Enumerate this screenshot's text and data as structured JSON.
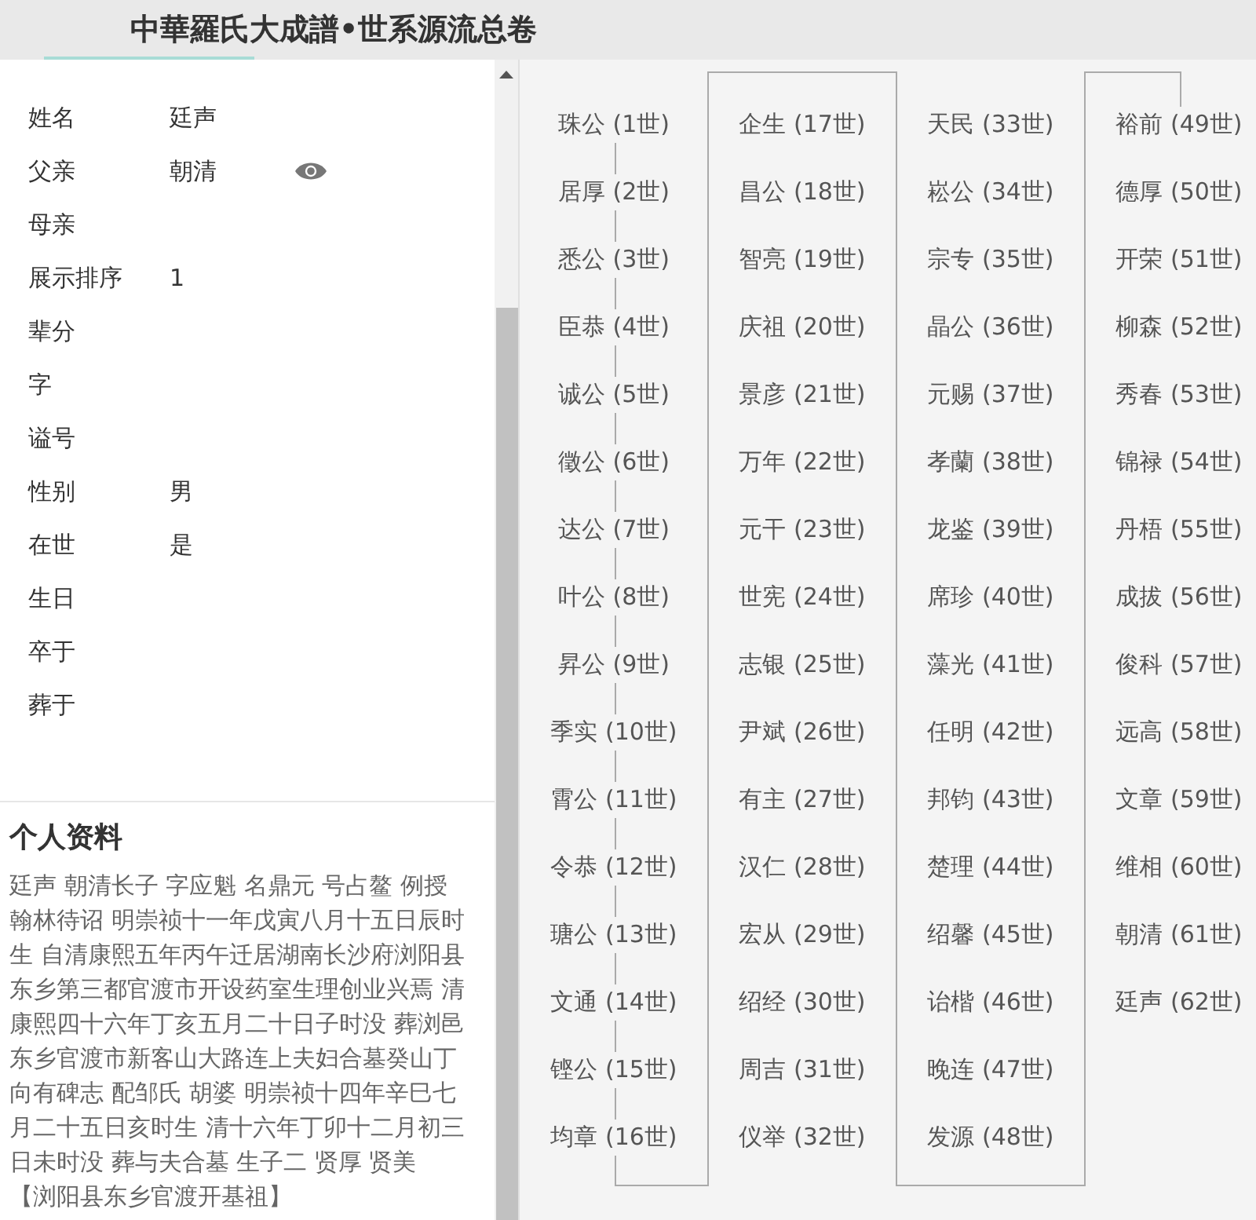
{
  "header": {
    "title": "中華羅氏大成譜•世系源流总卷"
  },
  "profile": {
    "fields": [
      {
        "label": "姓名",
        "value": "廷声",
        "viewable": false
      },
      {
        "label": "父亲",
        "value": "朝清",
        "viewable": true
      },
      {
        "label": "母亲",
        "viewable": false
      },
      {
        "label": "展示排序",
        "value": "1",
        "viewable": false
      },
      {
        "label": "辈分",
        "viewable": false
      },
      {
        "label": "字",
        "viewable": false
      },
      {
        "label": "谥号",
        "viewable": false
      },
      {
        "label": "性别",
        "value": "男",
        "viewable": false
      },
      {
        "label": "在世",
        "value": "是",
        "viewable": false
      },
      {
        "label": "生日",
        "viewable": false
      },
      {
        "label": "卒于",
        "viewable": false
      },
      {
        "label": "葬于",
        "viewable": false
      }
    ]
  },
  "biography": {
    "heading": "个人资料",
    "text": "廷声 朝清长子 字应魁 名鼎元 号占鳌 例授翰林待诏 明崇祯十一年戊寅八月十五日辰时生 自清康熙五年丙午迁居湖南长沙府浏阳县东乡第三都官渡市开设药室生理创业兴焉 清康熙四十六年丁亥五月二十日子时没 葬浏邑东乡官渡市新客山大路连上夫妇合墓癸山丁向有碑志 配邹氏 胡婆 明崇祯十四年辛巳七月二十五日亥时生 清十六年丁卯十二月初三日未时没 葬与夫合墓 生子二 贤厚 贤美",
    "note": "【浏阳县东乡官渡开基祖】"
  },
  "lineage": [
    "珠公 (1世)",
    "居厚 (2世)",
    "悉公 (3世)",
    "臣恭 (4世)",
    "诚公 (5世)",
    "徵公 (6世)",
    "达公 (7世)",
    "叶公 (8世)",
    "昇公 (9世)",
    "季实 (10世)",
    "霄公 (11世)",
    "令恭 (12世)",
    "瑭公 (13世)",
    "文通 (14世)",
    "铿公 (15世)",
    "均章 (16世)",
    "企生 (17世)",
    "昌公 (18世)",
    "智亮 (19世)",
    "庆祖 (20世)",
    "景彦 (21世)",
    "万年 (22世)",
    "元干 (23世)",
    "世宪 (24世)",
    "志银 (25世)",
    "尹斌 (26世)",
    "有主 (27世)",
    "汉仁 (28世)",
    "宏从 (29世)",
    "绍经 (30世)",
    "周吉 (31世)",
    "仪举 (32世)",
    "天民 (33世)",
    "崧公 (34世)",
    "宗专 (35世)",
    "晶公 (36世)",
    "元赐 (37世)",
    "孝蘭 (38世)",
    "龙鉴 (39世)",
    "席珍 (40世)",
    "藻光 (41世)",
    "任明 (42世)",
    "邦钧 (43世)",
    "楚理 (44世)",
    "绍馨 (45世)",
    "诒楷 (46世)",
    "晚连 (47世)",
    "发源 (48世)",
    "裕前 (49世)",
    "德厚 (50世)",
    "开荣 (51世)",
    "柳森 (52世)",
    "秀春 (53世)",
    "锦禄 (54世)",
    "丹梧 (55世)",
    "成拔 (56世)",
    "俊科 (57世)",
    "远高 (58世)",
    "文章 (59世)",
    "维相 (60世)",
    "朝清 (61世)",
    "廷声 (62世)"
  ]
}
